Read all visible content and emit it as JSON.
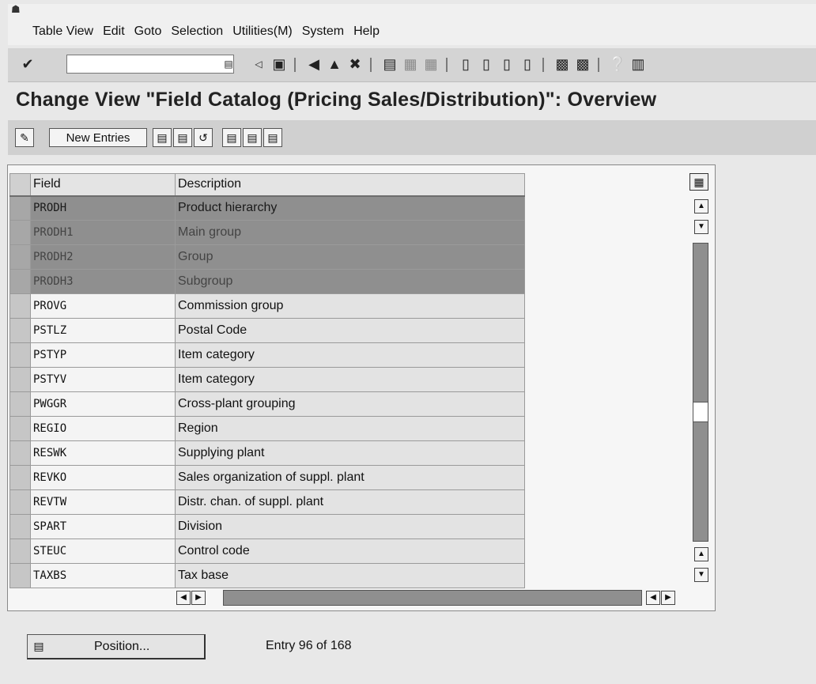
{
  "menubar": {
    "items": [
      "Table View",
      "Edit",
      "Goto",
      "Selection",
      "Utilities(M)",
      "System",
      "Help"
    ]
  },
  "toolbar": {
    "command_field_value": "",
    "icons": [
      "enter-icon",
      "history-icon",
      "back-arrow-icon",
      "save-icon",
      "back-icon",
      "exit-icon",
      "cancel-icon",
      "print-icon",
      "find-icon",
      "find-next-icon",
      "first-page-icon",
      "previous-page-icon",
      "next-page-icon",
      "last-page-icon",
      "create-session-icon",
      "shortcut-icon",
      "help-icon",
      "layout-icon"
    ]
  },
  "title": "Change View \"Field Catalog (Pricing Sales/Distribution)\": Overview",
  "app_toolbar": {
    "new_entries_label": "New Entries"
  },
  "table": {
    "columns": [
      "Field",
      "Description"
    ],
    "rows": [
      {
        "field": "PRODH",
        "description": "Product hierarchy",
        "selected": true
      },
      {
        "field": "PRODH1",
        "description": "Main group",
        "selected": true
      },
      {
        "field": "PRODH2",
        "description": "Group",
        "selected": true
      },
      {
        "field": "PRODH3",
        "description": "Subgroup",
        "selected": true
      },
      {
        "field": "PROVG",
        "description": "Commission group",
        "selected": false
      },
      {
        "field": "PSTLZ",
        "description": "Postal Code",
        "selected": false
      },
      {
        "field": "PSTYP",
        "description": "Item category",
        "selected": false
      },
      {
        "field": "PSTYV",
        "description": "Item category",
        "selected": false
      },
      {
        "field": "PWGGR",
        "description": "Cross-plant grouping",
        "selected": false
      },
      {
        "field": "REGIO",
        "description": "Region",
        "selected": false
      },
      {
        "field": "RESWK",
        "description": "Supplying plant",
        "selected": false
      },
      {
        "field": "REVKO",
        "description": "Sales organization of suppl. plant",
        "selected": false
      },
      {
        "field": "REVTW",
        "description": "Distr. chan. of suppl. plant",
        "selected": false
      },
      {
        "field": "SPART",
        "description": "Division",
        "selected": false
      },
      {
        "field": "STEUC",
        "description": "Control code",
        "selected": false
      },
      {
        "field": "TAXBS",
        "description": "Tax base",
        "selected": false
      }
    ]
  },
  "bottom": {
    "position_label": "Position...",
    "entry_info": "Entry 96 of 168"
  }
}
